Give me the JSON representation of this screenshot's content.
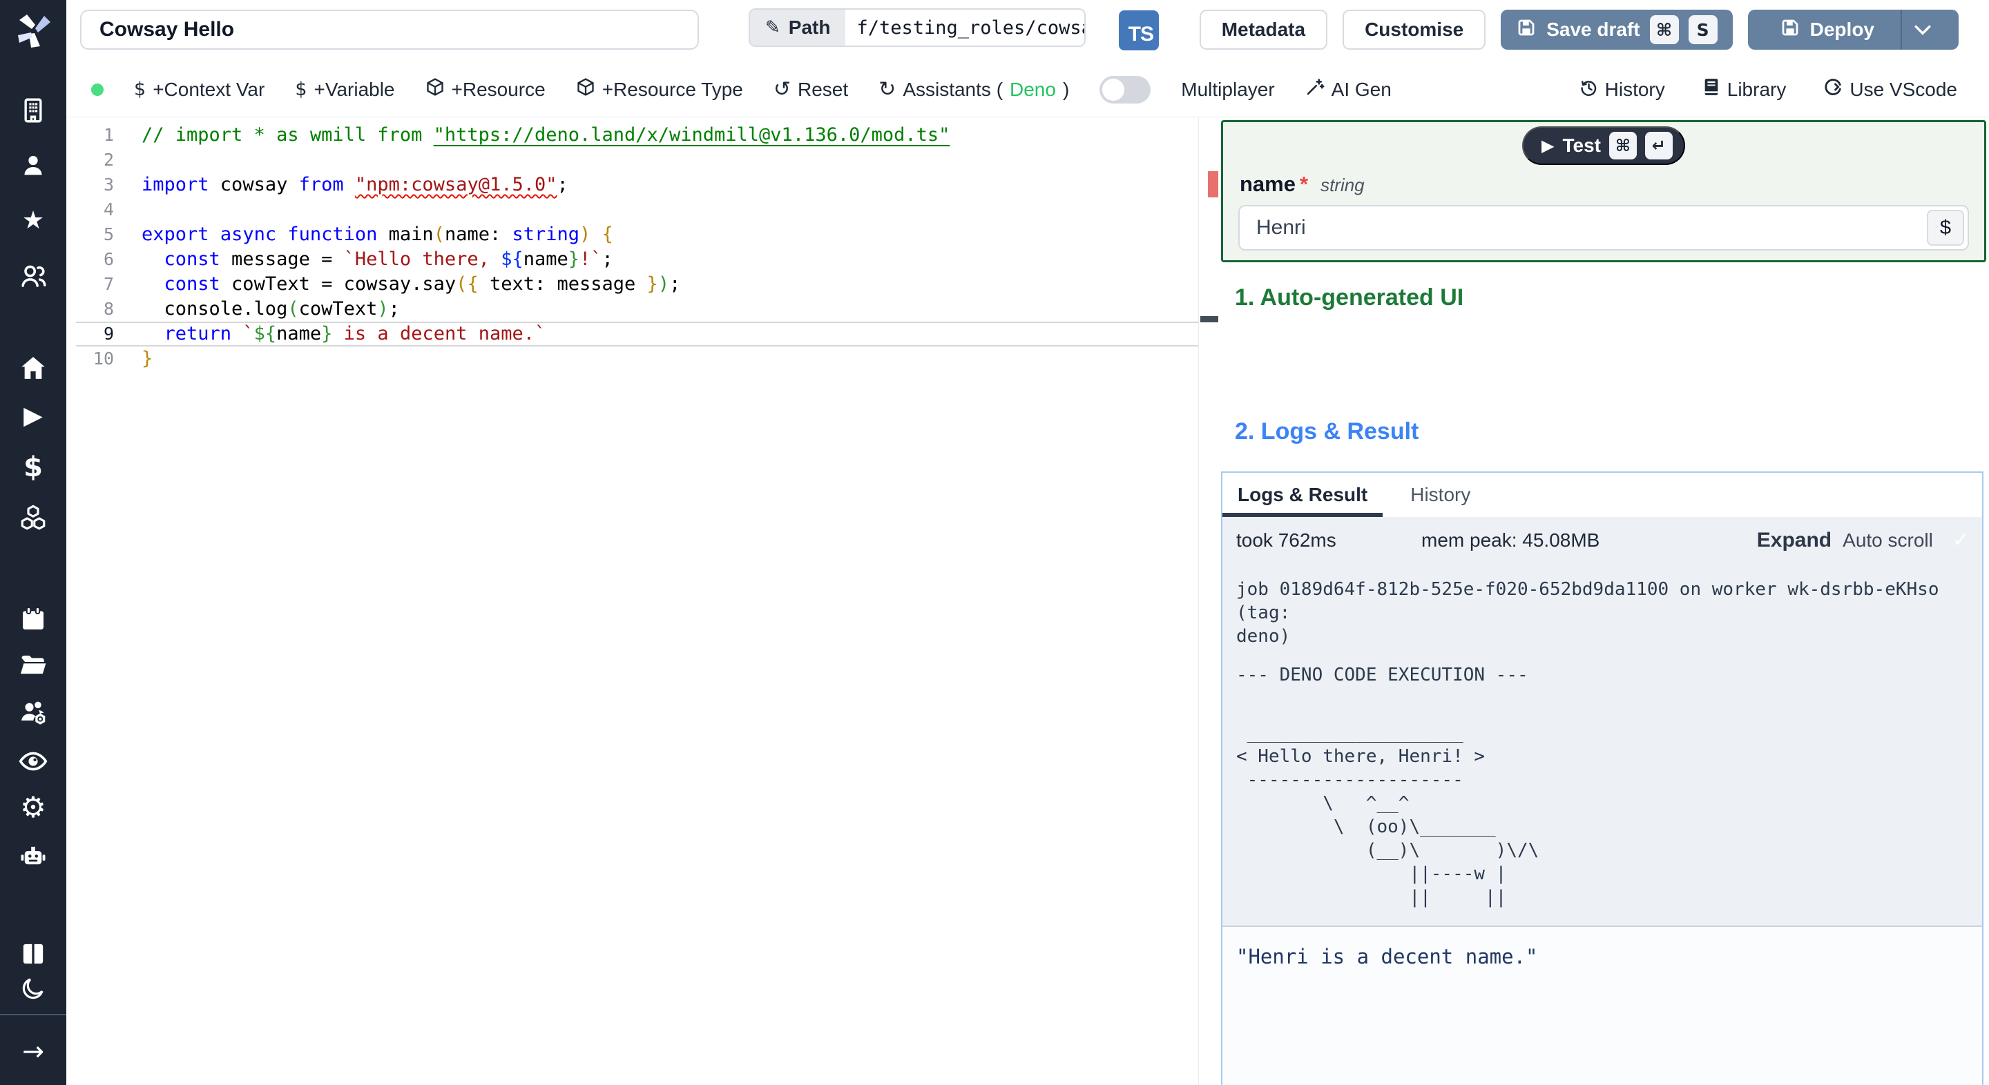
{
  "topbar": {
    "title_value": "Cowsay Hello",
    "path_label": "Path",
    "path_value": "f/testing_roles/cowsa",
    "language_badge": "TS",
    "metadata_label": "Metadata",
    "customise_label": "Customise",
    "save_draft_label": "Save draft",
    "deploy_label": "Deploy"
  },
  "icons": {
    "pencil": "✎",
    "command": "⌘",
    "save_key": "S",
    "return": "↵",
    "play": "▶",
    "star": "★",
    "dollar": "$",
    "gear": "⚙",
    "arrow_right": "→",
    "reset": "↺",
    "refresh": "↻",
    "check": "✓"
  },
  "toolbar": {
    "context_var": "+Context Var",
    "variable": "+Variable",
    "resource": "+Resource",
    "resource_type": "+Resource Type",
    "reset": "Reset",
    "assistants_prefix": "Assistants (",
    "assistants_lang": "Deno",
    "assistants_suffix": ")",
    "multiplayer": "Multiplayer",
    "ai_gen": "AI Gen",
    "history": "History",
    "library": "Library",
    "use_vscode": "Use VScode"
  },
  "editor": {
    "line_numbers": [
      "1",
      "2",
      "3",
      "4",
      "5",
      "6",
      "7",
      "8",
      "9",
      "10"
    ],
    "lines": [
      {
        "tokens": [
          {
            "c": "cmt",
            "t": "// import * as wmill from "
          },
          {
            "c": "link",
            "t": "\"https://deno.land/x/windmill@v1.136.0/mod.ts\""
          }
        ]
      },
      {
        "tokens": []
      },
      {
        "tokens": [
          {
            "c": "kw",
            "t": "import"
          },
          {
            "c": "pl",
            "t": " cowsay "
          },
          {
            "c": "kw",
            "t": "from"
          },
          {
            "c": "pl",
            "t": " "
          },
          {
            "c": "sq",
            "t": "\"npm:cowsay@1.5.0\""
          },
          {
            "c": "pl",
            "t": ";"
          }
        ]
      },
      {
        "tokens": []
      },
      {
        "tokens": [
          {
            "c": "kw",
            "t": "export"
          },
          {
            "c": "pl",
            "t": " "
          },
          {
            "c": "kw",
            "t": "async"
          },
          {
            "c": "pl",
            "t": " "
          },
          {
            "c": "kw",
            "t": "function"
          },
          {
            "c": "pl",
            "t": " main"
          },
          {
            "c": "b1",
            "t": "("
          },
          {
            "c": "pl",
            "t": "name: "
          },
          {
            "c": "kw",
            "t": "string"
          },
          {
            "c": "b1",
            "t": ")"
          },
          {
            "c": "pl",
            "t": " "
          },
          {
            "c": "b1",
            "t": "{"
          }
        ]
      },
      {
        "tokens": [
          {
            "c": "pl",
            "t": "  "
          },
          {
            "c": "kw",
            "t": "const"
          },
          {
            "c": "pl",
            "t": " message = "
          },
          {
            "c": "str",
            "t": "`Hello there, "
          },
          {
            "c": "b3",
            "t": "${"
          },
          {
            "c": "pl",
            "t": "name"
          },
          {
            "c": "b2",
            "t": "}"
          },
          {
            "c": "str",
            "t": "!`"
          },
          {
            "c": "pl",
            "t": ";"
          }
        ]
      },
      {
        "tokens": [
          {
            "c": "pl",
            "t": "  "
          },
          {
            "c": "kw",
            "t": "const"
          },
          {
            "c": "pl",
            "t": " cowText = cowsay.say"
          },
          {
            "c": "b1",
            "t": "("
          },
          {
            "c": "b1",
            "t": "{"
          },
          {
            "c": "pl",
            "t": " text: message "
          },
          {
            "c": "b1",
            "t": "}"
          },
          {
            "c": "b2",
            "t": ")"
          },
          {
            "c": "pl",
            "t": ";"
          }
        ]
      },
      {
        "tokens": [
          {
            "c": "pl",
            "t": "  console.log"
          },
          {
            "c": "b2",
            "t": "("
          },
          {
            "c": "pl",
            "t": "cowText"
          },
          {
            "c": "b2",
            "t": ")"
          },
          {
            "c": "pl",
            "t": ";"
          }
        ]
      },
      {
        "tokens": [
          {
            "c": "pl",
            "t": "  "
          },
          {
            "c": "kw",
            "t": "return"
          },
          {
            "c": "pl",
            "t": " "
          },
          {
            "c": "str",
            "t": "`"
          },
          {
            "c": "b2",
            "t": "${"
          },
          {
            "c": "pl",
            "t": "name"
          },
          {
            "c": "b2",
            "t": "}"
          },
          {
            "c": "str",
            "t": " is a decent name.`"
          }
        ]
      },
      {
        "tokens": [
          {
            "c": "b1",
            "t": "}"
          }
        ]
      }
    ]
  },
  "test_panel": {
    "test_label": "Test",
    "field_name": "name",
    "required_mark": "*",
    "field_type": "string",
    "input_value": "Henri",
    "var_button": "$"
  },
  "sections": {
    "auto_ui": "1. Auto-generated UI",
    "logs_result": "2. Logs & Result"
  },
  "logs": {
    "tab_active": "Logs & Result",
    "tab_history": "History",
    "took": "took 762ms",
    "mem": "mem peak: 45.08MB",
    "expand": "Expand",
    "autoscroll": "Auto scroll",
    "job_line": "job 0189d64f-812b-525e-f020-652bd9da1100 on worker wk-dsrbb-eKHso (tag:\ndeno)",
    "exec_header": "--- DENO CODE EXECUTION ---",
    "cowsay": " ____________________\n< Hello there, Henri! >\n --------------------\n        \\   ^__^\n         \\  (oo)\\_______\n            (__)\\       )\\/\\\n                ||----w |\n                ||     ||",
    "result": "\"Henri is a decent name.\""
  }
}
